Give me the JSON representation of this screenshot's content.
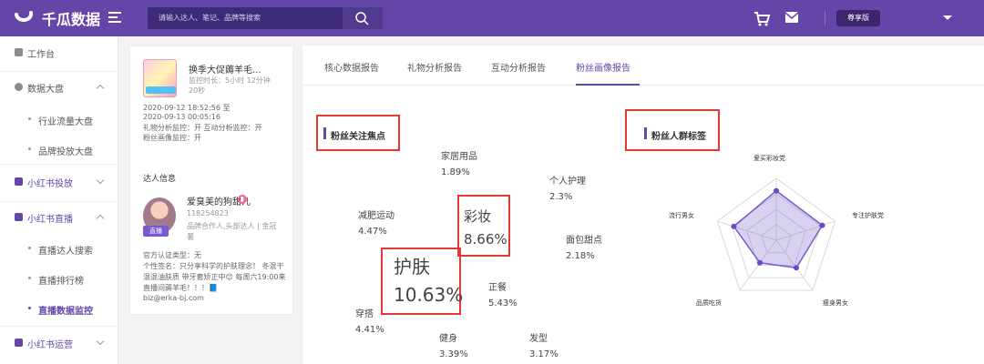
{
  "header": {
    "brand": "千瓜数据",
    "search_placeholder": "请输入达人、笔记、品牌等搜索",
    "edition_label": "尊享版"
  },
  "sidebar": {
    "items": [
      {
        "label": "工作台"
      },
      {
        "label": "数据大盘"
      },
      {
        "label": "行业流量大盘"
      },
      {
        "label": "品牌投放大盘"
      },
      {
        "label": "小红书投放"
      },
      {
        "label": "小红书直播"
      },
      {
        "label": "直播达人搜索"
      },
      {
        "label": "直播排行榜"
      },
      {
        "label": "直播数据监控"
      },
      {
        "label": "小红书运营"
      }
    ]
  },
  "left_panel": {
    "live_title": "换季大促薅羊毛...",
    "duration_label": "监控时长：",
    "duration_value": "5小时 12分钟",
    "duration_seconds": "20秒",
    "time_range_line1": "2020-09-12 18:52:56 至",
    "time_range_line2": "2020-09-13 00:05:16",
    "monitor_line1": "礼物分析监控：开     互动分析监控：开",
    "monitor_line2": "粉丝画像监控：开",
    "host_section_label": "达人信息",
    "host_name": "爱臭美的狗甜儿",
    "host_id": "118254823",
    "host_tags": "品牌合作人,头部达人   |  金冠薯",
    "live_tag": "直播",
    "verify_line": "官方认证类型：无",
    "bio": "个性签名：只分享科学的护肤理念！  冬混干混混油肤质  带牙套矫正中😊  每周六19:00来直播间薅羊毛！！！📘",
    "email": "biz@erka-bj.com"
  },
  "tabs": [
    {
      "label": "核心数据报告",
      "active": false
    },
    {
      "label": "礼物分析报告",
      "active": false
    },
    {
      "label": "互动分析报告",
      "active": false
    },
    {
      "label": "粉丝画像报告",
      "active": true
    }
  ],
  "sections": {
    "focus_title": "粉丝关注焦点",
    "crowd_title": "粉丝人群标签"
  },
  "focus_items": [
    {
      "name": "家居用品",
      "value": "1.89%"
    },
    {
      "name": "个人护理",
      "value": "2.3%"
    },
    {
      "name": "减肥运动",
      "value": "4.47%"
    },
    {
      "name": "彩妆",
      "value": "8.66%"
    },
    {
      "name": "面包甜点",
      "value": "2.18%"
    },
    {
      "name": "护肤",
      "value": "10.63%"
    },
    {
      "name": "正餐",
      "value": "5.43%"
    },
    {
      "name": "穿搭",
      "value": "4.41%"
    },
    {
      "name": "健身",
      "value": "3.39%"
    },
    {
      "name": "发型",
      "value": "3.17%"
    }
  ],
  "chart_data": {
    "type": "radar",
    "axes": [
      "爱买彩妆党",
      "专注护肤党",
      "瘦身男女",
      "品质吃货",
      "流行男女"
    ],
    "values": [
      0.8,
      0.78,
      0.55,
      0.45,
      0.72
    ],
    "max": 1,
    "title": "粉丝人群标签"
  }
}
